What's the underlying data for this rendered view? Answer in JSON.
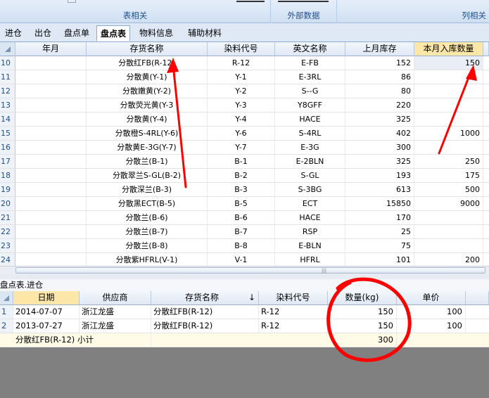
{
  "ribbon": {
    "groups": [
      {
        "title": "表相关"
      },
      {
        "title": "外部数据"
      },
      {
        "title": "列相关"
      }
    ]
  },
  "tabs": [
    "进仓",
    "出仓",
    "盘点单",
    "盘点表",
    "物料信息",
    "辅助材料"
  ],
  "active_tab": "盘点表",
  "top_grid": {
    "columns": [
      "年月",
      "存货名称",
      "染料代号",
      "英文名称",
      "上月库存",
      "本月入库数量"
    ],
    "rows": [
      {
        "n": "10",
        "ym": "",
        "name": "分散红FB(R-12)",
        "code": "R-12",
        "en": "E-FB",
        "stock": "152",
        "inq": "150"
      },
      {
        "n": "11",
        "ym": "",
        "name": "分散黄(Y-1)",
        "code": "Y-1",
        "en": "E-3RL",
        "stock": "86",
        "inq": ""
      },
      {
        "n": "12",
        "ym": "",
        "name": "分散嫩黄(Y-2)",
        "code": "Y-2",
        "en": "S--G",
        "stock": "80",
        "inq": ""
      },
      {
        "n": "13",
        "ym": "",
        "name": "分散荧光黄(Y-3",
        "code": "Y-3",
        "en": "Y8GFF",
        "stock": "220",
        "inq": ""
      },
      {
        "n": "14",
        "ym": "",
        "name": "分散黄(Y-4)",
        "code": "Y-4",
        "en": "HACE",
        "stock": "325",
        "inq": ""
      },
      {
        "n": "15",
        "ym": "",
        "name": "分散橙S-4RL(Y-6)",
        "code": "Y-6",
        "en": "S-4RL",
        "stock": "402",
        "inq": "1000"
      },
      {
        "n": "16",
        "ym": "",
        "name": "分散黄E-3G(Y-7)",
        "code": "Y-7",
        "en": "E-3G",
        "stock": "300",
        "inq": ""
      },
      {
        "n": "17",
        "ym": "",
        "name": "分散兰(B-1)",
        "code": "B-1",
        "en": "E-2BLN",
        "stock": "325",
        "inq": "250"
      },
      {
        "n": "18",
        "ym": "",
        "name": "分散翠兰S-GL(B-2)",
        "code": "B-2",
        "en": "S-GL",
        "stock": "193",
        "inq": "175"
      },
      {
        "n": "19",
        "ym": "",
        "name": "分散深兰(B-3)",
        "code": "B-3",
        "en": "S-3BG",
        "stock": "613",
        "inq": "500"
      },
      {
        "n": "20",
        "ym": "",
        "name": "分散黑ECT(B-5)",
        "code": "B-5",
        "en": "ECT",
        "stock": "15850",
        "inq": "9000"
      },
      {
        "n": "21",
        "ym": "",
        "name": "分散兰(B-6)",
        "code": "B-6",
        "en": "HACE",
        "stock": "170",
        "inq": ""
      },
      {
        "n": "22",
        "ym": "",
        "name": "分散兰(B-7)",
        "code": "B-7",
        "en": "RSP",
        "stock": "25",
        "inq": ""
      },
      {
        "n": "23",
        "ym": "",
        "name": "分散兰(B-8)",
        "code": "B-8",
        "en": "E-BLN",
        "stock": "75",
        "inq": ""
      },
      {
        "n": "24",
        "ym": "",
        "name": "分散紫HFRL(V-1)",
        "code": "V-1",
        "en": "HFRL",
        "stock": "101",
        "inq": "200"
      }
    ]
  },
  "panel_title": "盘点表.进仓",
  "bottom_grid": {
    "columns": [
      "日期",
      "供应商",
      "存货名称",
      "染料代号",
      "数量(kg)",
      "单价"
    ],
    "rows": [
      {
        "n": "1",
        "date": "2014-07-07",
        "supplier": "浙江龙盛",
        "name": "分散红FB(R-12)",
        "code": "R-12",
        "qty": "150",
        "price": "100"
      },
      {
        "n": "2",
        "date": "2013-07-27",
        "supplier": "浙江龙盛",
        "name": "分散红FB(R-12)",
        "code": "R-12",
        "qty": "150",
        "price": "100"
      }
    ],
    "subtotal": {
      "label": "分散红FB(R-12) 小计",
      "qty": "300"
    }
  },
  "colors": {
    "annotation": "#ff0000",
    "selected_header": "#fde7a8",
    "subtotal_row": "#fffbe6"
  }
}
